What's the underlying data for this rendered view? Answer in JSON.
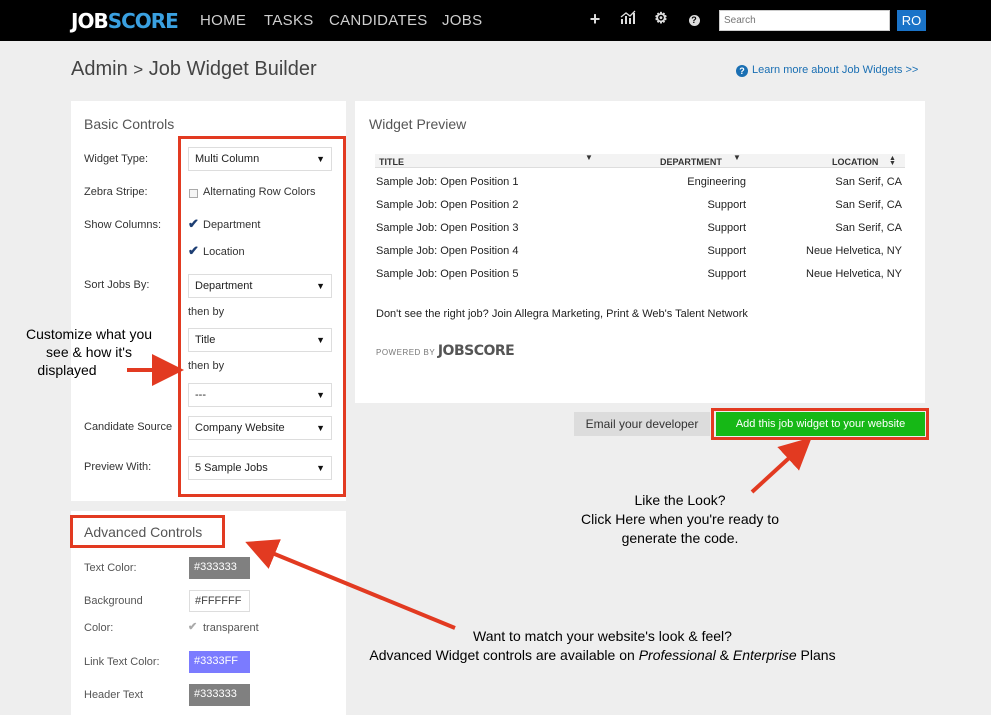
{
  "topbar": {
    "logo_job": "JOB",
    "logo_score": "SCORE",
    "nav": [
      "HOME",
      "TASKS",
      "CANDIDATES",
      "JOBS"
    ],
    "icons": [
      "plus-icon",
      "chart-icon",
      "gear-icon",
      "help-icon"
    ],
    "search_placeholder": "Search",
    "avatar": "RO"
  },
  "breadcrumb": {
    "parent": "Admin",
    "separator": ">",
    "current": "Job Widget Builder"
  },
  "learn_more": "Learn more about Job Widgets >>",
  "basic": {
    "title": "Basic Controls",
    "widget_type_label": "Widget Type:",
    "widget_type_value": "Multi Column",
    "zebra_label": "Zebra Stripe:",
    "zebra_option": "Alternating Row Colors",
    "show_columns_label": "Show Columns:",
    "col_department": "Department",
    "col_location": "Location",
    "sort_label": "Sort Jobs By:",
    "sort_1": "Department",
    "then_by_1": "then by",
    "sort_2": "Title",
    "then_by_2": "then by",
    "sort_3": "---",
    "source_label": "Candidate Source",
    "source_value": "Company Website",
    "preview_label": "Preview With:",
    "preview_value": "5 Sample Jobs"
  },
  "advanced": {
    "title": "Advanced Controls",
    "text_color_label": "Text Color:",
    "text_color_value": "#333333",
    "background_label": "Background",
    "background_value": "#FFFFFF",
    "color_label": "Color:",
    "transparent_label": "transparent",
    "link_color_label": "Link Text Color:",
    "link_color_value": "#3333FF",
    "header_text_label": "Header Text",
    "header_text_value": "#333333"
  },
  "preview": {
    "title": "Widget Preview",
    "columns": [
      "TITLE",
      "DEPARTMENT",
      "LOCATION"
    ],
    "rows": [
      {
        "title": "Sample Job: Open Position 1",
        "dept": "Engineering",
        "loc": "San Serif, CA"
      },
      {
        "title": "Sample Job: Open Position 2",
        "dept": "Support",
        "loc": "San Serif, CA"
      },
      {
        "title": "Sample Job: Open Position 3",
        "dept": "Support",
        "loc": "San Serif, CA"
      },
      {
        "title": "Sample Job: Open Position 4",
        "dept": "Support",
        "loc": "Neue Helvetica, NY"
      },
      {
        "title": "Sample Job: Open Position 5",
        "dept": "Support",
        "loc": "Neue Helvetica, NY"
      }
    ],
    "footer": "Don't see the right job? Join Allegra Marketing, Print & Web's Talent Network",
    "powered_by": "POWERED BY",
    "powered_logo": "JOBSCORE"
  },
  "buttons": {
    "email": "Email your developer",
    "add": "Add this job widget to your website"
  },
  "annotations": {
    "left_1": "Customize what you",
    "left_2": "see & how it's",
    "left_3": "displayed",
    "right_1": "Like the Look?",
    "right_2": "Click Here when you're ready to",
    "right_3": "generate the code.",
    "bottom_1": "Want to match your website's look & feel?",
    "bottom_2a": "Advanced Widget controls are available on ",
    "bottom_2b": "Professional",
    "bottom_2c": " & ",
    "bottom_2d": "Enterprise",
    "bottom_2e": " Plans"
  },
  "colors": {
    "accent_red": "#e23a21",
    "add_green": "#16b816",
    "link_blue": "#1a6fb3",
    "swatch_gray": "#808080",
    "swatch_link": "#7b7bff"
  }
}
